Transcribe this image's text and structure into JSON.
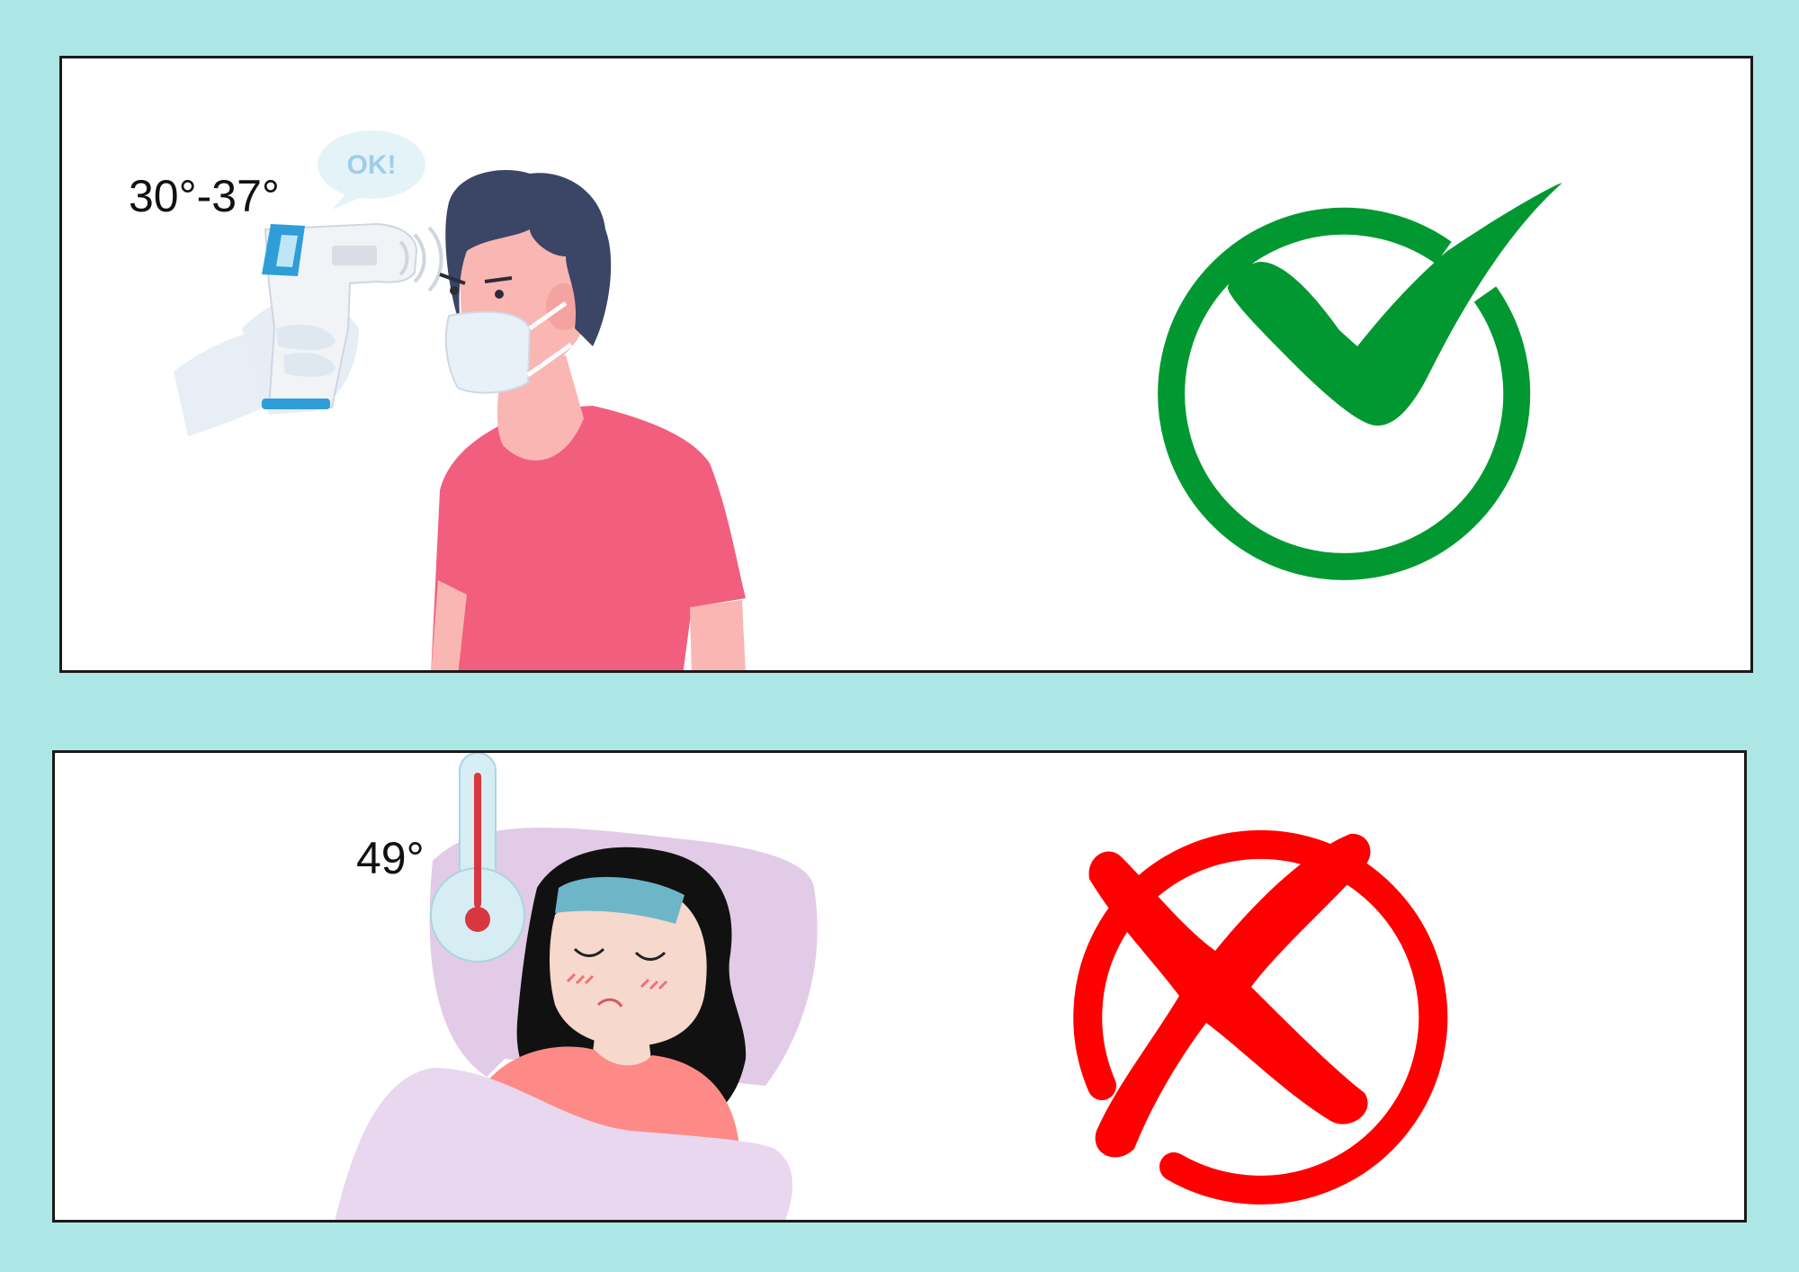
{
  "panels": {
    "normal": {
      "temperature_label": "30°-37°",
      "speech_bubble": "OK!",
      "result_icon": "check-icon",
      "result_color": "#019831"
    },
    "fever": {
      "temperature_label": "49°",
      "result_icon": "x-icon",
      "result_color": "#ff0000"
    }
  },
  "colors": {
    "background": "#ace7e6",
    "panel": "#ffffff",
    "shirt": "#f25f7e",
    "hair": "#3b4565",
    "thermometer": "#2f9ed8",
    "pillow": "#e2cbe6",
    "blanket": "#e8d7ee"
  }
}
